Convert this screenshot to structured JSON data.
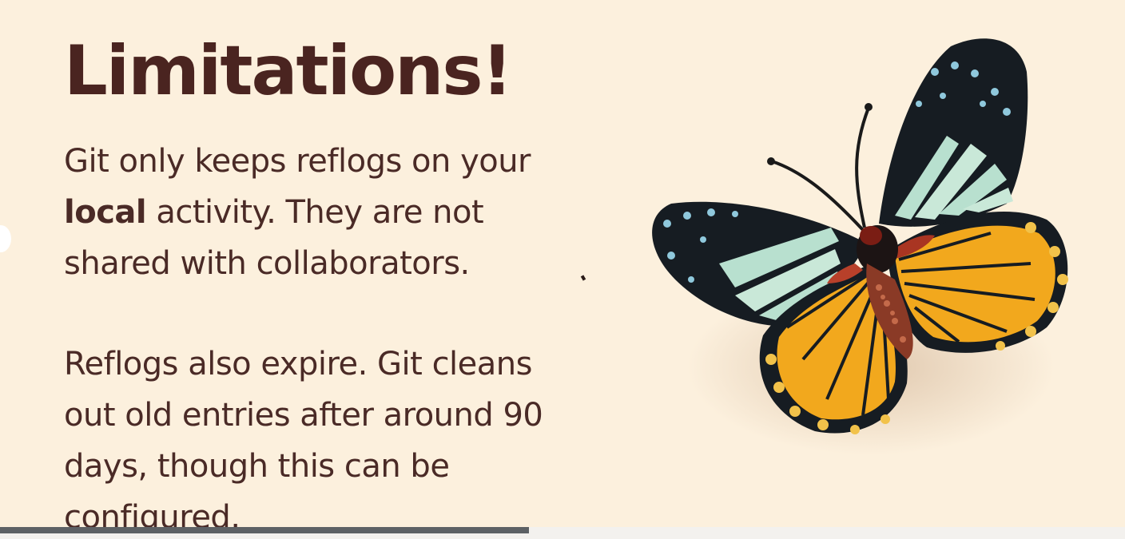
{
  "slide": {
    "title": "Limitations!",
    "paragraph1": {
      "line1": "Git only keeps reflogs on your",
      "bold": "local",
      "line2_rest": " activity.  They are not",
      "line3": "shared with collaborators."
    },
    "paragraph2": {
      "line1": "Reflogs also expire.  Git cleans",
      "line2": "out old entries after around 90",
      "line3": "days, though this can be",
      "line4": "configured."
    },
    "image": "butterfly-illustration"
  },
  "video_progress": {
    "fraction": 0.47
  },
  "colors": {
    "background": "#fcf0dd",
    "title": "#4a2420",
    "text": "#4a2a26",
    "wing_orange": "#f2a81d",
    "wing_teal": "#b8e0cf",
    "wing_dark": "#161c22"
  }
}
